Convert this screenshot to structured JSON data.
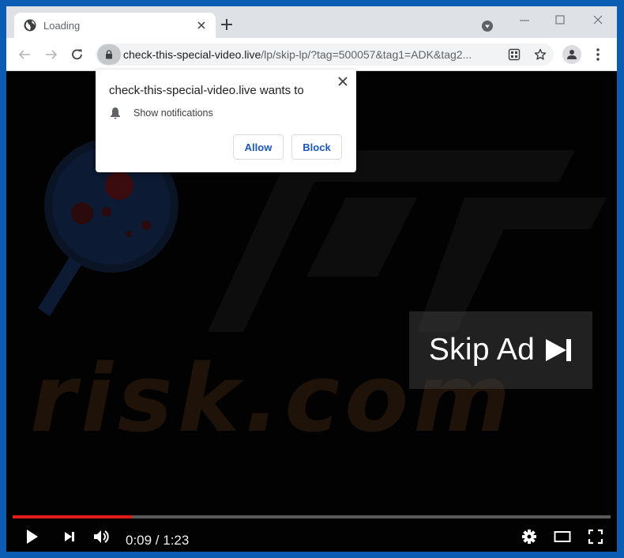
{
  "browser": {
    "tab": {
      "title": "Loading",
      "icon": "globe-icon"
    },
    "url": {
      "host": "check-this-special-video.live",
      "path": "/lp/skip-lp/?tag=500057&tag1=ADK&tag2..."
    },
    "icons": [
      "back-icon",
      "forward-icon",
      "reload-icon",
      "lock-icon",
      "qr-code-icon",
      "star-icon",
      "profile-icon",
      "menu-icon",
      "tab-search-icon",
      "minimize-icon",
      "maximize-icon",
      "close-icon",
      "new-tab-icon"
    ]
  },
  "prompt": {
    "title": "check-this-special-video.live wants to",
    "permission": "Show notifications",
    "allow_label": "Allow",
    "block_label": "Block"
  },
  "video": {
    "skip_label": "Skip Ad",
    "current_time": "0:09",
    "duration": "1:23",
    "time_display": "0:09 / 1:23",
    "progress_fraction": 0.2
  },
  "colors": {
    "frame_border": "#0a5db3",
    "progress_played": "#e21b1b",
    "button_text": "#1a57b8"
  }
}
